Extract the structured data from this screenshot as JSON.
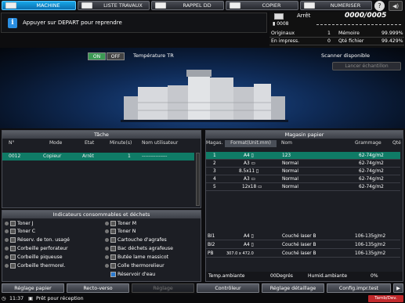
{
  "tabs": [
    {
      "label": "MACHINE",
      "active": true
    },
    {
      "label": "LISTE TRAVAUX",
      "active": false
    },
    {
      "label": "RAPPEL DD",
      "active": false
    },
    {
      "label": "COPIER",
      "active": false
    },
    {
      "label": "NUMERISER",
      "active": false
    }
  ],
  "message": "Appuyer sur DEPART pour reprendre",
  "counter": {
    "status": "Arrêt",
    "count": "0000/0005",
    "job_no": "0008",
    "originals_label": "Originaux",
    "originals_value": "1",
    "memory_label": "Mémoire",
    "memory_value": "99.999%",
    "printing_label": "En impress.",
    "printing_value": "0",
    "file_label": "Qté fichier",
    "file_value": "99.429%"
  },
  "hero": {
    "on": "ON",
    "off": "OFF",
    "temp_label": "Température TR",
    "scanner": "Scanner disponible",
    "sample_button": "Lancer échantillon"
  },
  "jobs": {
    "title": "Tâche",
    "columns": [
      "N°",
      "Mode",
      "Etat",
      "Minute(s)",
      "Nom utilisateur"
    ],
    "rows": [
      [
        "0012",
        "Copieur",
        "Arrêt",
        "1",
        "---------------"
      ]
    ]
  },
  "consumables": {
    "title": "Indicateurs consommables et déchets",
    "left": [
      "Toner J",
      "Toner C",
      "Réserv. de ton. usagé",
      "Corbeille perforateur",
      "Corbeille piqueuse",
      "Corbeille thermorel."
    ],
    "right": [
      "Toner M",
      "Toner N",
      "Cartouche d'agrafes",
      "Bac déchets agrafeuse",
      "Butée lame massicot",
      "Colle thermorelieur",
      "Réservoir d'eau"
    ]
  },
  "trays": {
    "title": "Magasin papier",
    "columns": [
      "Magas.",
      "Format(Unit.mm)",
      "Nom",
      "Grammage",
      "Qté"
    ],
    "rows": [
      {
        "tray": "1",
        "size": "A4",
        "name": "123",
        "weight": "62-74g/m2",
        "selected": true
      },
      {
        "tray": "2",
        "size": "A3",
        "name": "Normal",
        "weight": "62-74g/m2",
        "selected": false
      },
      {
        "tray": "3",
        "size": "8.5x11",
        "name": "Normal",
        "weight": "62-74g/m2",
        "selected": false
      },
      {
        "tray": "4",
        "size": "A3",
        "name": "Normal",
        "weight": "62-74g/m2",
        "selected": false
      },
      {
        "tray": "5",
        "size": "12x18",
        "name": "Normal",
        "weight": "62-74g/m2",
        "selected": false
      }
    ],
    "bottom": [
      {
        "tray": "BI1",
        "size": "A4",
        "name": "Couché laser B",
        "weight": "106-135g/m2"
      },
      {
        "tray": "BI2",
        "size": "A4",
        "name": "Couché laser B",
        "weight": "106-135g/m2"
      },
      {
        "tray": "PB",
        "size": "307.0 x 472.0",
        "name": "Couché laser B",
        "weight": "106-135g/m2"
      }
    ],
    "temp_label": "Temp.ambiante",
    "temp_value": "00Degrés",
    "hum_label": "Humid.ambiante",
    "hum_value": "0%"
  },
  "buttons": [
    "Réglage papier",
    "Recto-verso",
    "Réglage",
    "Contrôleur",
    "Réglage détaillage",
    "Config.impr.test"
  ],
  "status": {
    "time": "11:37",
    "text": "Prêt pour réception",
    "right": "Tamb/Dev."
  }
}
